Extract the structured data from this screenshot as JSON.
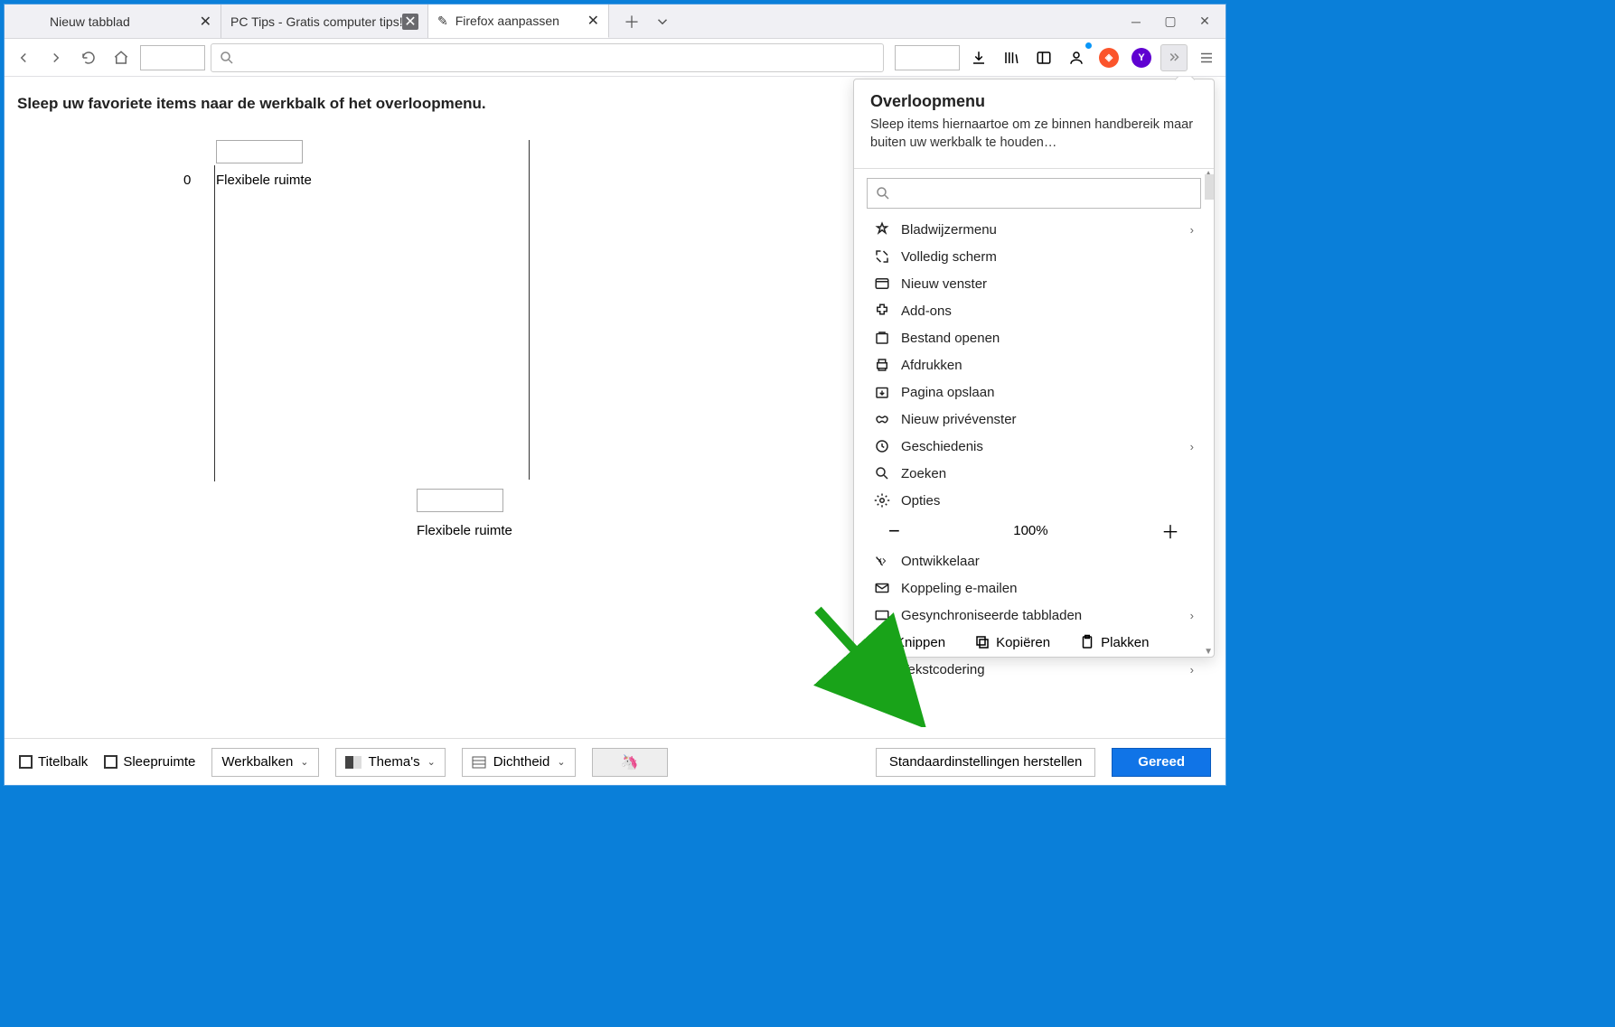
{
  "tabs": [
    {
      "title": "Nieuw tabblad"
    },
    {
      "title": "PC Tips - Gratis computer tips! - PC"
    },
    {
      "title": "Firefox aanpassen"
    }
  ],
  "main": {
    "heading": "Sleep uw favoriete items naar de werkbalk of het overloopmenu.",
    "zero": "0",
    "flex1": "Flexibele ruimte",
    "flex2": "Flexibele ruimte"
  },
  "panel": {
    "title": "Overloopmenu",
    "desc": "Sleep items hiernaartoe om ze binnen handbereik maar buiten uw werkbalk te houden…",
    "items": [
      {
        "label": "Bladwijzermenu",
        "chevron": true
      },
      {
        "label": "Volledig scherm"
      },
      {
        "label": "Nieuw venster"
      },
      {
        "label": "Add-ons"
      },
      {
        "label": "Bestand openen"
      },
      {
        "label": "Afdrukken"
      },
      {
        "label": "Pagina opslaan"
      },
      {
        "label": "Nieuw privévenster"
      },
      {
        "label": "Geschiedenis",
        "chevron": true
      },
      {
        "label": "Zoeken"
      },
      {
        "label": "Opties"
      }
    ],
    "zoom": "100%",
    "tail": [
      {
        "label": "Ontwikkelaar"
      },
      {
        "label": "Koppeling e-mailen"
      },
      {
        "label": "Gesynchroniseerde tabbladen",
        "chevron": true
      }
    ],
    "triple": {
      "cut": "Knippen",
      "copy": "Kopiëren",
      "paste": "Plakken"
    },
    "textenc": {
      "label": "Tekstcodering",
      "chevron": true
    }
  },
  "footer": {
    "titlebar": "Titelbalk",
    "dragspace": "Sleepruimte",
    "toolbars": "Werkbalken",
    "themes": "Thema's",
    "density": "Dichtheid",
    "restore": "Standaardinstellingen herstellen",
    "done": "Gereed"
  }
}
